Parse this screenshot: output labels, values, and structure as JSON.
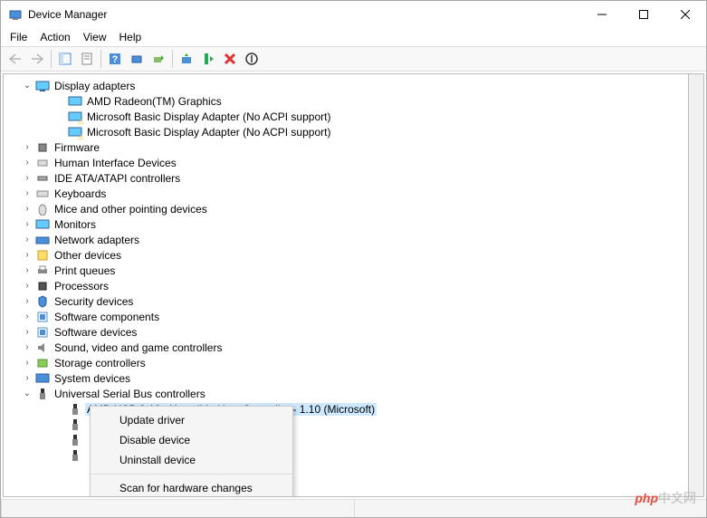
{
  "window": {
    "title": "Device Manager"
  },
  "menu": {
    "file": "File",
    "action": "Action",
    "view": "View",
    "help": "Help"
  },
  "tree": {
    "display_adapters": {
      "label": "Display adapters",
      "children": [
        "AMD Radeon(TM) Graphics",
        "Microsoft Basic Display Adapter (No ACPI support)",
        "Microsoft Basic Display Adapter (No ACPI support)"
      ]
    },
    "firmware": "Firmware",
    "hid": "Human Interface Devices",
    "ide": "IDE ATA/ATAPI controllers",
    "keyboards": "Keyboards",
    "mice": "Mice and other pointing devices",
    "monitors": "Monitors",
    "network": "Network adapters",
    "other": "Other devices",
    "print": "Print queues",
    "processors": "Processors",
    "security": "Security devices",
    "swcomp": "Software components",
    "swdev": "Software devices",
    "sound": "Sound, video and game controllers",
    "storage": "Storage controllers",
    "system": "System devices",
    "usb": {
      "label": "Universal Serial Bus controllers",
      "selected": "AMD USB 3.10 eXtensible Host Controller - 1.10 (Microsoft)"
    }
  },
  "context_menu": {
    "update": "Update driver",
    "disable": "Disable device",
    "uninstall": "Uninstall device",
    "scan": "Scan for hardware changes"
  },
  "watermark": {
    "brand": "php",
    "text": "中文网"
  }
}
